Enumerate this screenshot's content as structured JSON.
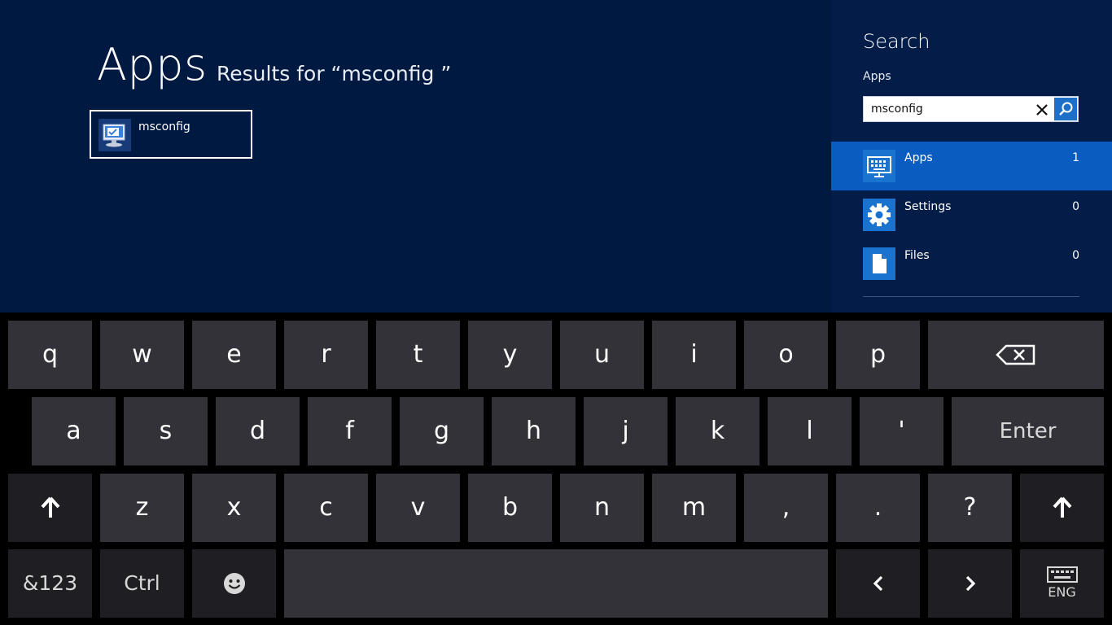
{
  "results": {
    "heading": "Apps",
    "query_label": "Results for “msconfig ”",
    "items": [
      {
        "label": "msconfig",
        "icon": "msconfig-app-icon"
      }
    ]
  },
  "search_pane": {
    "title": "Search",
    "scope": "Apps",
    "query": "msconfig",
    "clear_icon": "✕",
    "categories": [
      {
        "label": "Apps",
        "count": "1",
        "icon": "apps-icon",
        "selected": true
      },
      {
        "label": "Settings",
        "count": "0",
        "icon": "settings-gear-icon",
        "selected": false
      },
      {
        "label": "Files",
        "count": "0",
        "icon": "file-icon",
        "selected": false
      }
    ]
  },
  "keyboard": {
    "row1": [
      "q",
      "w",
      "e",
      "r",
      "t",
      "y",
      "u",
      "i",
      "o",
      "p"
    ],
    "row2": [
      "a",
      "s",
      "d",
      "f",
      "g",
      "h",
      "j",
      "k",
      "l",
      "'"
    ],
    "enter": "Enter",
    "row3": [
      "z",
      "x",
      "c",
      "v",
      "b",
      "n",
      "m",
      ",",
      ".",
      "?"
    ],
    "num_sym": "&123",
    "ctrl": "Ctrl",
    "language": "ENG",
    "icons": {
      "backspace": "backspace-icon",
      "shift": "shift-arrow-icon",
      "emoji": "emoji-icon",
      "left": "left-arrow-icon",
      "right": "right-arrow-icon",
      "keyboard": "keyboard-layout-icon"
    }
  },
  "colors": {
    "results_bg": "#001941",
    "pane_bg": "#031c48",
    "selected_category": "#0b5cc0",
    "accent": "#1e6fc7",
    "key": "#333238",
    "key_dark": "#1f1e23"
  }
}
